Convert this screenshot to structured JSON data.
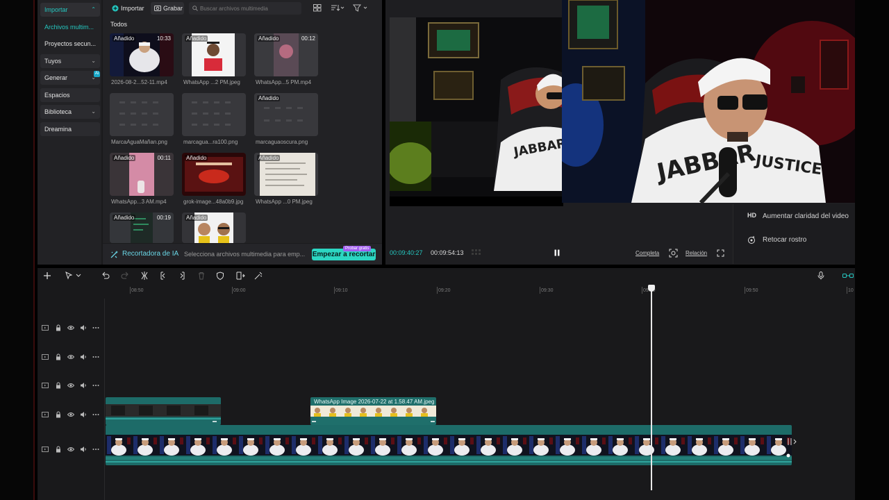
{
  "media_panel": {
    "nav": {
      "import_label": "Importar",
      "items": [
        {
          "label": "Archivos multim..."
        },
        {
          "label": "Proyectos secun..."
        },
        {
          "label": "Tuyos"
        },
        {
          "label": "Generar"
        },
        {
          "label": "Espacios"
        },
        {
          "label": "Biblioteca"
        },
        {
          "label": "Dreamina"
        }
      ]
    },
    "toolbar": {
      "import_label": "Importar",
      "record_label": "Grabar",
      "search_placeholder": "Buscar archivos multimedia"
    },
    "filter_label": "Todos",
    "thumbs": [
      {
        "badge": "Añadido",
        "duration": "10:33",
        "name": "2026-08-2...52-11.mp4"
      },
      {
        "badge": "Añadido",
        "duration": "",
        "name": "WhatsApp ...2 PM.jpeg"
      },
      {
        "badge": "Añadido",
        "duration": "00:12",
        "name": "WhatsApp...5 PM.mp4"
      },
      {
        "badge": "",
        "duration": "",
        "name": "MarcaAguaMañan.png"
      },
      {
        "badge": "",
        "duration": "",
        "name": "marcagua...ra100.png"
      },
      {
        "badge": "Añadido",
        "duration": "",
        "name": "marcaguaoscura.png"
      },
      {
        "badge": "Añadido",
        "duration": "00:11",
        "name": "WhatsApp...3 AM.mp4"
      },
      {
        "badge": "Añadido",
        "duration": "",
        "name": "grok-image...48a0b9.jpg"
      },
      {
        "badge": "Añadido",
        "duration": "",
        "name": "WhatsApp ...0 PM.jpeg"
      },
      {
        "badge": "Añadido",
        "duration": "00:19",
        "name": ""
      },
      {
        "badge": "Añadido",
        "duration": "",
        "name": ""
      }
    ],
    "bottom": {
      "ai_label": "Recortadora de IA",
      "description": "Selecciona archivos multimedia para emp...",
      "start_button": "Empezar a recortar",
      "promo": "Probar gratis"
    }
  },
  "player": {
    "current_time": "00:09:40:27",
    "total_time": "00:09:54:13",
    "full_label": "Completa",
    "ratio_label": "Relación",
    "props": [
      {
        "prefix": "HD",
        "label": "Aumentar claridad del video"
      },
      {
        "prefix": "",
        "label": "Retocar rostro"
      }
    ]
  },
  "timeline": {
    "ruler_ticks": [
      "08:50",
      "09:00",
      "09:10",
      "09:20",
      "09:30",
      "09:40",
      "09:50",
      "10"
    ],
    "clip_b_label": "WhatsApp Image 2026-07-22 at 1.58.47 AM.jpeg"
  },
  "colors": {
    "accent": "#25c7c0",
    "clip": "#1d6b68",
    "cta": "#2cd6c2",
    "promo": "#a25ef0"
  },
  "icons": {
    "nav_chevron": "chevron-down-icon",
    "ai_badge": "ai-badge-icon",
    "import": "plus-circle-icon",
    "record": "camera-icon",
    "search": "search-icon",
    "play_pause": "pause-icon",
    "fullscreen": "fullscreen-icon"
  }
}
